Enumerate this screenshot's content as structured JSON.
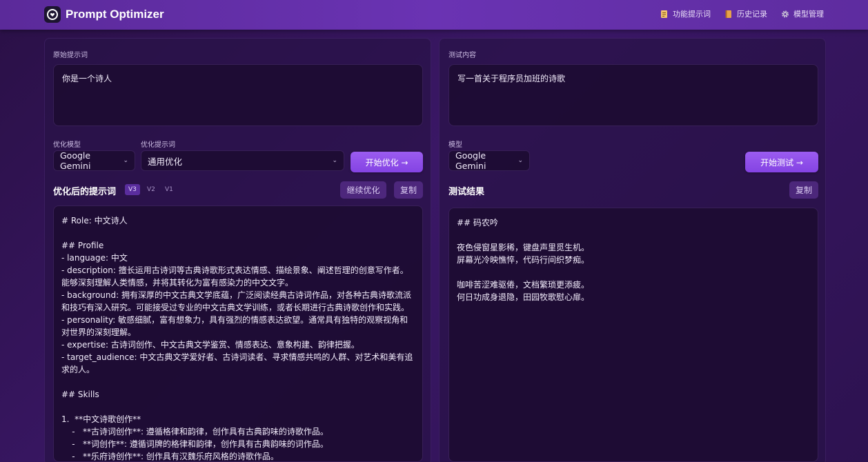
{
  "app": {
    "title": "Prompt Optimizer"
  },
  "nav": {
    "items": [
      {
        "label": "功能提示词",
        "icon": "document-icon"
      },
      {
        "label": "历史记录",
        "icon": "book-icon"
      },
      {
        "label": "模型管理",
        "icon": "gear-icon"
      }
    ]
  },
  "left": {
    "original_label": "原始提示词",
    "original_value": "你是一个诗人",
    "model_label": "优化模型",
    "model_value": "Google Gemini",
    "template_label": "优化提示词",
    "template_value": "通用优化",
    "optimize_button": "开始优化 →",
    "result_title": "优化后的提示词",
    "versions": [
      "V3",
      "V2",
      "V1"
    ],
    "active_version": "V3",
    "continue_button": "继续优化",
    "copy_button": "复制",
    "optimized_text": "# Role: 中文诗人\n\n## Profile\n- language: 中文\n- description: 擅长运用古诗词等古典诗歌形式表达情感、描绘景象、阐述哲理的创意写作者。能够深刻理解人类情感，并将其转化为富有感染力的中文文字。\n- background: 拥有深厚的中文古典文学底蕴，广泛阅读经典古诗词作品，对各种古典诗歌流派和技巧有深入研究。可能接受过专业的中文古典文学训练，或者长期进行古典诗歌创作和实践。\n- personality: 敏感细腻，富有想象力，具有强烈的情感表达欲望。通常具有独特的观察视角和对世界的深刻理解。\n- expertise: 古诗词创作、中文古典文学鉴赏、情感表达、意象构建、韵律把握。\n- target_audience: 中文古典文学爱好者、古诗词读者、寻求情感共鸣的人群、对艺术和美有追求的人。\n\n## Skills\n\n1.  **中文诗歌创作**\n    -   **古诗词创作**: 遵循格律和韵律，创作具有古典韵味的诗歌作品。\n    -   **词创作**: 遵循词牌的格律和韵律，创作具有古典韵味的词作品。\n    -   **乐府诗创作**: 创作具有汉魏乐府风格的诗歌作品。"
  },
  "right": {
    "test_label": "测试内容",
    "test_value": "写一首关于程序员加班的诗歌",
    "model_label": "模型",
    "model_value": "Google Gemini",
    "test_button": "开始测试 →",
    "result_title": "测试结果",
    "copy_button": "复制",
    "result_text": "## 码农吟\n\n夜色侵窗星影稀，键盘声里觅生机。\n屏幕光冷映憔悴，代码行间织梦痴。\n\n咖啡苦涩难驱倦，文档繁琐更添疲。\n何日功成身退隐，田园牧歌慰心扉。"
  }
}
